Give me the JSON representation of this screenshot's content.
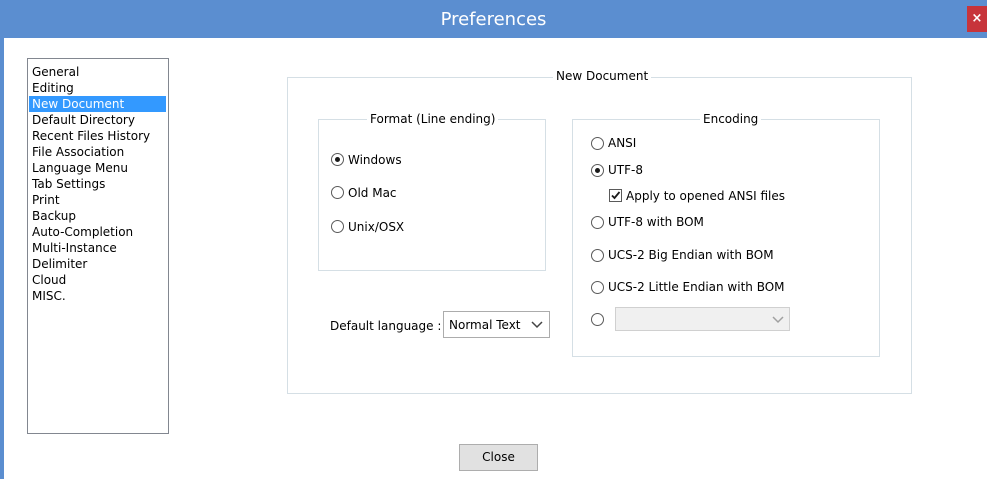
{
  "window": {
    "title": "Preferences",
    "close_glyph": "×"
  },
  "sidebar": {
    "items": [
      {
        "label": "General"
      },
      {
        "label": "Editing"
      },
      {
        "label": "New Document"
      },
      {
        "label": "Default Directory"
      },
      {
        "label": "Recent Files History"
      },
      {
        "label": "File Association"
      },
      {
        "label": "Language Menu"
      },
      {
        "label": "Tab Settings"
      },
      {
        "label": "Print"
      },
      {
        "label": "Backup"
      },
      {
        "label": "Auto-Completion"
      },
      {
        "label": "Multi-Instance"
      },
      {
        "label": "Delimiter"
      },
      {
        "label": "Cloud"
      },
      {
        "label": "MISC."
      }
    ],
    "selected": "New Document"
  },
  "new_document": {
    "group_title": "New Document",
    "format": {
      "title": "Format (Line ending)",
      "options": [
        {
          "label": "Windows",
          "checked": true
        },
        {
          "label": "Old Mac",
          "checked": false
        },
        {
          "label": "Unix/OSX",
          "checked": false
        }
      ]
    },
    "encoding": {
      "title": "Encoding",
      "options": [
        {
          "label": "ANSI",
          "checked": false
        },
        {
          "label": "UTF-8",
          "checked": true
        },
        {
          "label": "UTF-8 with BOM",
          "checked": false
        },
        {
          "label": "UCS-2 Big Endian with BOM",
          "checked": false
        },
        {
          "label": "UCS-2 Little Endian with BOM",
          "checked": false
        }
      ],
      "apply_ansi": {
        "label": "Apply to opened ANSI files",
        "checked": true
      },
      "other_select_value": ""
    },
    "default_language": {
      "label": "Default language :",
      "value": "Normal Text"
    }
  },
  "footer": {
    "close_label": "Close"
  }
}
